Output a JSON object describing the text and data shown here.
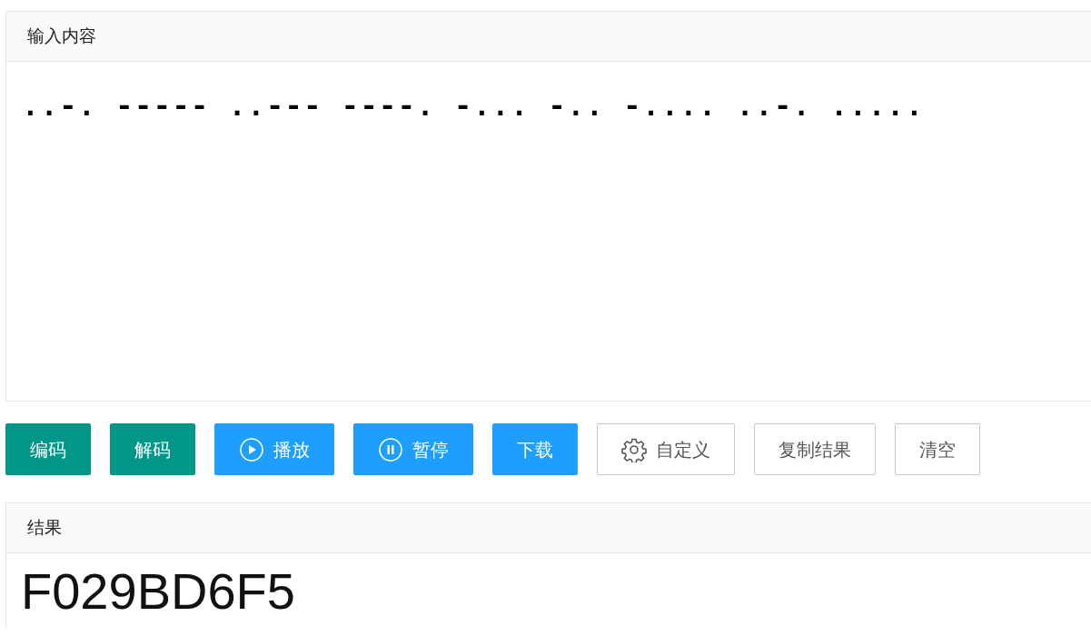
{
  "input_panel": {
    "title": "输入内容",
    "value": "..-. ----- ..--- ----. -... -.. -.... ..-. ....."
  },
  "buttons": [
    {
      "label": "编码",
      "kind": "teal"
    },
    {
      "label": "解码",
      "kind": "teal"
    },
    {
      "label": "播放",
      "kind": "play"
    },
    {
      "label": "暂停",
      "kind": "pause"
    },
    {
      "label": "下载",
      "kind": "blue"
    },
    {
      "label": "自定义",
      "kind": "gear"
    },
    {
      "label": "复制结果",
      "kind": "plain"
    },
    {
      "label": "清空",
      "kind": "plain"
    }
  ],
  "result_panel": {
    "title": "结果",
    "value": "F029BD6F5"
  }
}
